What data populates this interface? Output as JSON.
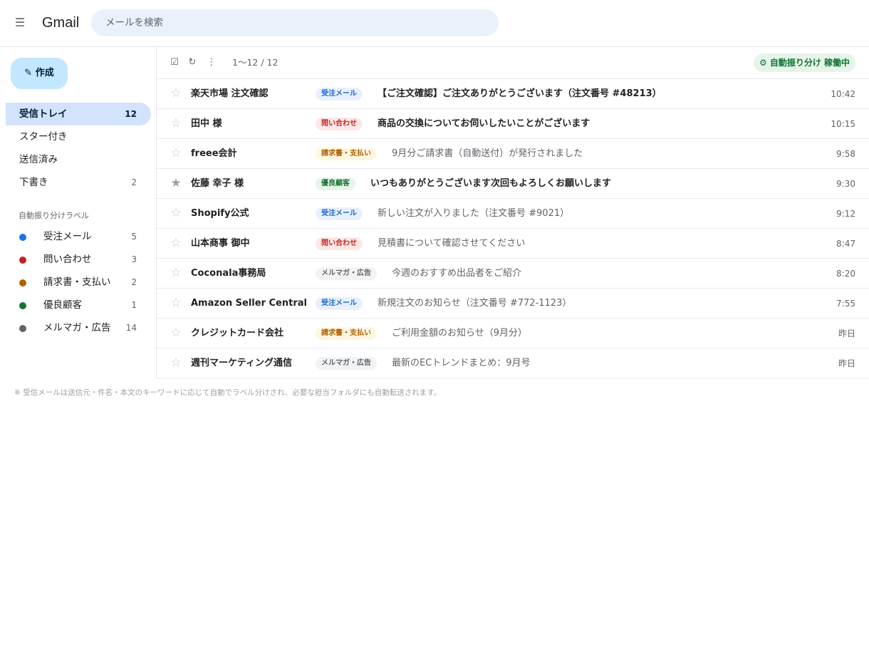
{
  "header": {
    "menu_icon": "hamburger-menu-icon",
    "app_name": "Gmail",
    "search_placeholder": "メールを検索"
  },
  "sidebar": {
    "compose_label": "✎ 作成",
    "nav": [
      {
        "label": "受信トレイ",
        "count": "12",
        "active": true
      },
      {
        "label": "スター付き",
        "count": ""
      },
      {
        "label": "送信済み",
        "count": ""
      },
      {
        "label": "下書き",
        "count": "2"
      }
    ],
    "labels_title": "自動振り分けラベル",
    "labels": [
      {
        "name": "受注メール",
        "count": "5",
        "color": "#1a73e8"
      },
      {
        "name": "問い合わせ",
        "count": "3",
        "color": "#c5221f"
      },
      {
        "name": "請求書・支払い",
        "count": "2",
        "color": "#b06000"
      },
      {
        "name": "優良顧客",
        "count": "1",
        "color": "#137333"
      },
      {
        "name": "メルマガ・広告",
        "count": "14",
        "color": "#5f6368"
      }
    ]
  },
  "toolbar": {
    "select_icon": "checkbox-icon",
    "refresh_icon": "refresh-icon",
    "more_icon": "more-vertical-icon",
    "page_range": "1〜12 / 12",
    "auto_status": "⚙ 自動振り分け 稼働中"
  },
  "tag_styles": {
    "受注メール": {
      "bg": "#e8f0fe",
      "fg": "#1967d2"
    },
    "問い合わせ": {
      "bg": "#fce8e6",
      "fg": "#c5221f"
    },
    "請求書・支払い": {
      "bg": "#fef7e0",
      "fg": "#b06000"
    },
    "優良顧客": {
      "bg": "#e6f4ea",
      "fg": "#137333"
    },
    "メルマガ・広告": {
      "bg": "#f1f3f4",
      "fg": "#5f6368"
    }
  },
  "emails": [
    {
      "starred": false,
      "sender": "楽天市場 注文確認",
      "tag": "受注メール",
      "subject": "【ご注文確認】ご注文ありがとうございます（注文番号 #48213）",
      "time": "10:42",
      "unread": true
    },
    {
      "starred": false,
      "sender": "田中 様",
      "tag": "問い合わせ",
      "subject": "商品の交換についてお伺いしたいことがございます",
      "time": "10:15",
      "unread": true
    },
    {
      "starred": false,
      "sender": "freee会計",
      "tag": "請求書・支払い",
      "subject": "9月分ご請求書（自動送付）が発行されました",
      "time": "9:58",
      "unread": false
    },
    {
      "starred": true,
      "sender": "佐藤 幸子 様",
      "tag": "優良顧客",
      "subject": "いつもありがとうございます次回もよろしくお願いします",
      "time": "9:30",
      "unread": true
    },
    {
      "starred": false,
      "sender": "Shopify公式",
      "tag": "受注メール",
      "subject": "新しい注文が入りました（注文番号 #9021）",
      "time": "9:12",
      "unread": false
    },
    {
      "starred": false,
      "sender": "山本商事 御中",
      "tag": "問い合わせ",
      "subject": "見積書について確認させてください",
      "time": "8:47",
      "unread": false
    },
    {
      "starred": false,
      "sender": "Coconala事務局",
      "tag": "メルマガ・広告",
      "subject": "今週のおすすめ出品者をご紹介",
      "time": "8:20",
      "unread": false
    },
    {
      "starred": false,
      "sender": "Amazon Seller Central",
      "tag": "受注メール",
      "subject": "新規注文のお知らせ（注文番号 #772-1123）",
      "time": "7:55",
      "unread": false
    },
    {
      "starred": false,
      "sender": "クレジットカード会社",
      "tag": "請求書・支払い",
      "subject": "ご利用金額のお知らせ（9月分）",
      "time": "昨日",
      "unread": false
    },
    {
      "starred": false,
      "sender": "週刊マーケティング通信",
      "tag": "メルマガ・広告",
      "subject": "最新のECトレンドまとめ：9月号",
      "time": "昨日",
      "unread": false
    }
  ],
  "footnote": "※ 受信メールは送信元・件名・本文のキーワードに応じて自動でラベル分けされ、必要な担当フォルダにも自動転送されます。"
}
